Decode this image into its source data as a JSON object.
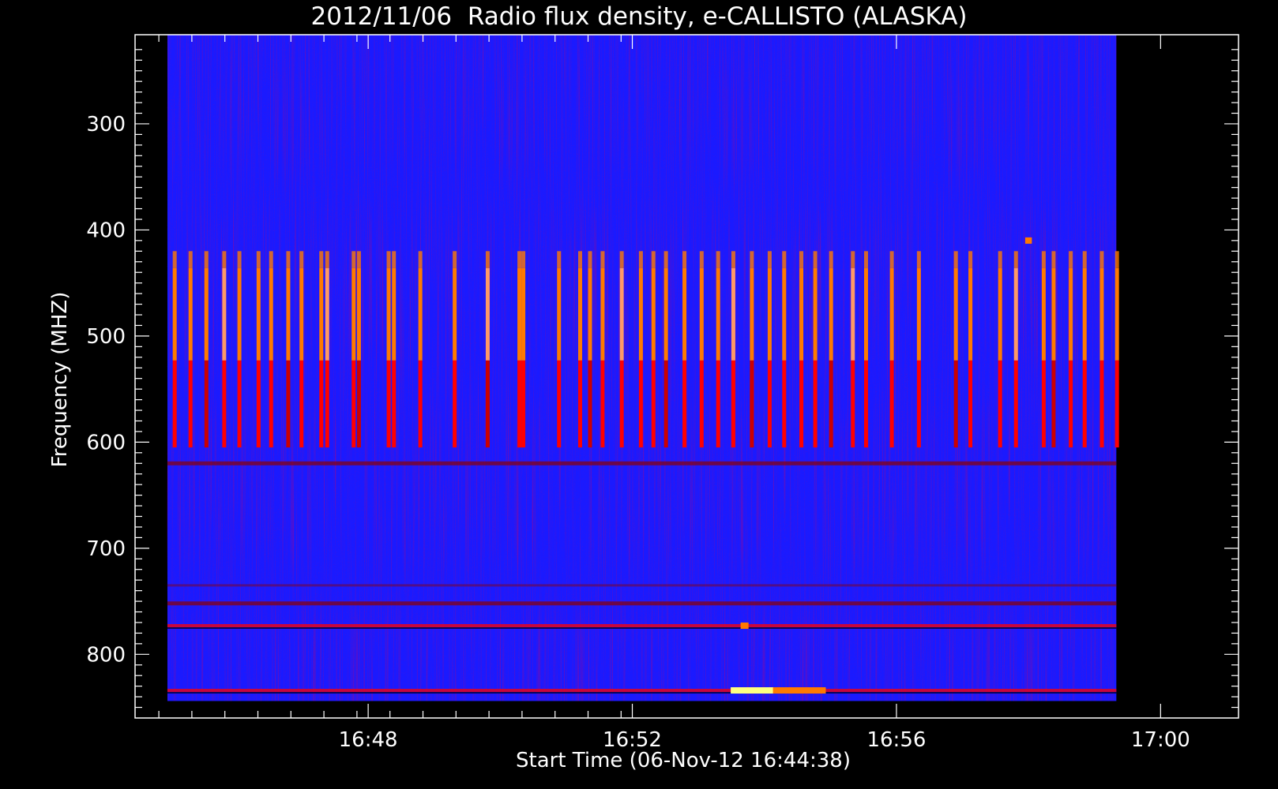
{
  "chart_data": {
    "type": "heatmap",
    "title": "2012/11/06  Radio flux density, e-CALLISTO (ALASKA)",
    "xlabel": "Start Time (06-Nov-12 16:44:38)",
    "ylabel": "Frequency (MHZ)",
    "y_reversed": true,
    "ylim": [
      216,
      860
    ],
    "data_freq_range": [
      216,
      844
    ],
    "xlim_minutes": [
      16.14,
      31.0
    ],
    "data_time_range_minutes": [
      16.63,
      31.0
    ],
    "y_ticks": [
      {
        "label": "300",
        "value": 300
      },
      {
        "label": "400",
        "value": 400
      },
      {
        "label": "500",
        "value": 500
      },
      {
        "label": "600",
        "value": 600
      },
      {
        "label": "700",
        "value": 700
      },
      {
        "label": "800",
        "value": 800
      }
    ],
    "x_ticks": [
      {
        "label": "16:48",
        "value": 19.67
      },
      {
        "label": "16:52",
        "value": 23.67
      },
      {
        "label": "16:56",
        "value": 27.67
      },
      {
        "label": "17:00",
        "value": 31.67
      }
    ],
    "colormap": [
      "#0000ff",
      "#8b0000",
      "#ff0000",
      "#ff7a00",
      "#ffff80"
    ],
    "background_color": "#1a1aff",
    "interference_band_freq": [
      436,
      605
    ],
    "interference_lines_minutes": [
      16.74,
      16.98,
      17.22,
      17.49,
      17.72,
      18.01,
      18.2,
      18.46,
      18.66,
      18.96,
      19.05,
      19.45,
      19.53,
      19.98,
      20.06,
      20.46,
      20.98,
      21.48,
      21.96,
      22.02,
      22.56,
      22.88,
      23.03,
      23.22,
      23.51,
      23.8,
      23.99,
      24.18,
      24.46,
      24.72,
      24.97,
      25.2,
      25.48,
      25.75,
      25.97,
      26.23,
      26.44,
      26.68,
      27.01,
      27.21,
      27.6,
      28.01,
      28.57,
      28.79,
      29.24,
      29.48,
      29.9,
      30.05,
      30.31,
      30.52,
      30.78,
      31.01
    ],
    "horizontal_bands": [
      {
        "freq": 620,
        "intensity": "moderate"
      },
      {
        "freq": 735,
        "intensity": "weak"
      },
      {
        "freq": 752,
        "intensity": "moderate"
      },
      {
        "freq": 773,
        "intensity": "strong"
      },
      {
        "freq": 834,
        "intensity": "strong"
      }
    ],
    "bursts": [
      {
        "time": 25.16,
        "freq": 834,
        "duration": 0.65,
        "intensity": "very strong"
      },
      {
        "time": 25.8,
        "freq": 834,
        "duration": 0.8,
        "intensity": "strong"
      },
      {
        "time": 25.31,
        "freq": 773,
        "duration": 0.12,
        "intensity": "strong"
      },
      {
        "time": 29.62,
        "freq": 410,
        "duration": 0.1,
        "intensity": "strong"
      }
    ],
    "grid": false,
    "legend": "none"
  }
}
